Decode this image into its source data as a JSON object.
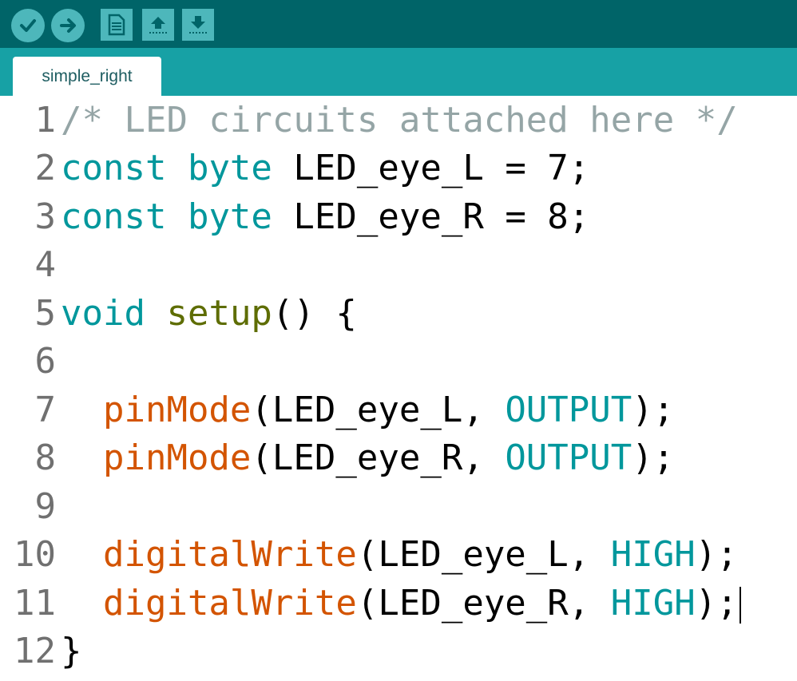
{
  "toolbar": {
    "buttons": [
      {
        "name": "verify",
        "icon": "checkmark-icon"
      },
      {
        "name": "upload",
        "icon": "arrow-right-icon"
      },
      {
        "name": "new",
        "icon": "new-file-icon"
      },
      {
        "name": "open",
        "icon": "open-arrow-up-icon"
      },
      {
        "name": "save",
        "icon": "save-arrow-down-icon"
      }
    ]
  },
  "tabs": [
    {
      "label": "simple_right"
    }
  ],
  "colors": {
    "toolbar_bg": "#006468",
    "tabbar_bg": "#17a1a5",
    "button_bg": "#4db7bb",
    "comment": "#95a5a6",
    "keyword": "#00979c",
    "function": "#d35400",
    "setup_fn": "#5e6d03"
  },
  "editor": {
    "lines": [
      {
        "num": "1",
        "tokens": [
          {
            "t": "/* LED circuits attached here */",
            "c": "comment"
          }
        ]
      },
      {
        "num": "2",
        "tokens": [
          {
            "t": "const",
            "c": "kw"
          },
          {
            "t": " ",
            "c": "plain"
          },
          {
            "t": "byte",
            "c": "kw"
          },
          {
            "t": " LED_eye_L = 7;",
            "c": "plain"
          }
        ]
      },
      {
        "num": "3",
        "tokens": [
          {
            "t": "const",
            "c": "kw"
          },
          {
            "t": " ",
            "c": "plain"
          },
          {
            "t": "byte",
            "c": "kw"
          },
          {
            "t": " LED_eye_R = 8;",
            "c": "plain"
          }
        ]
      },
      {
        "num": "4",
        "tokens": []
      },
      {
        "num": "5",
        "tokens": [
          {
            "t": "void",
            "c": "kw"
          },
          {
            "t": " ",
            "c": "plain"
          },
          {
            "t": "setup",
            "c": "fn2"
          },
          {
            "t": "() {",
            "c": "plain"
          }
        ]
      },
      {
        "num": "6",
        "tokens": []
      },
      {
        "num": "7",
        "tokens": [
          {
            "t": "  ",
            "c": "plain"
          },
          {
            "t": "pinMode",
            "c": "fn"
          },
          {
            "t": "(LED_eye_L, ",
            "c": "plain"
          },
          {
            "t": "OUTPUT",
            "c": "const"
          },
          {
            "t": ");",
            "c": "plain"
          }
        ]
      },
      {
        "num": "8",
        "tokens": [
          {
            "t": "  ",
            "c": "plain"
          },
          {
            "t": "pinMode",
            "c": "fn"
          },
          {
            "t": "(LED_eye_R, ",
            "c": "plain"
          },
          {
            "t": "OUTPUT",
            "c": "const"
          },
          {
            "t": ");",
            "c": "plain"
          }
        ]
      },
      {
        "num": "9",
        "tokens": []
      },
      {
        "num": "10",
        "tokens": [
          {
            "t": "  ",
            "c": "plain"
          },
          {
            "t": "digitalWrite",
            "c": "fn"
          },
          {
            "t": "(LED_eye_L, ",
            "c": "plain"
          },
          {
            "t": "HIGH",
            "c": "const"
          },
          {
            "t": ");",
            "c": "plain"
          }
        ]
      },
      {
        "num": "11",
        "tokens": [
          {
            "t": "  ",
            "c": "plain"
          },
          {
            "t": "digitalWrite",
            "c": "fn"
          },
          {
            "t": "(LED_eye_R, ",
            "c": "plain"
          },
          {
            "t": "HIGH",
            "c": "const"
          },
          {
            "t": ");",
            "c": "plain"
          }
        ],
        "cursor": true
      },
      {
        "num": "12",
        "tokens": [
          {
            "t": "}",
            "c": "plain"
          }
        ]
      }
    ]
  }
}
